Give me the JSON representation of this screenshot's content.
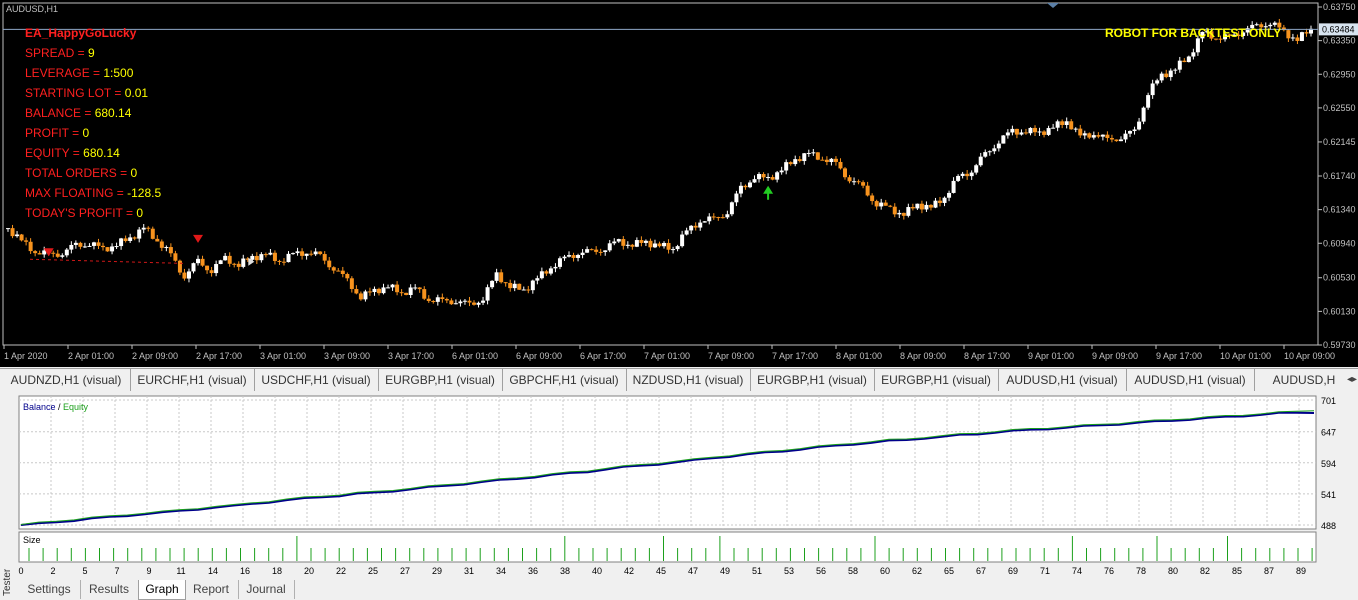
{
  "chart": {
    "symbol_label": "AUDUSD,H1",
    "watermark": "ROBOT FOR BACKTEST ONLY",
    "current_price": "0.63484",
    "bg_color": "#000000",
    "bull_color": "#ffffff",
    "bear_color": "#f7931e",
    "info_label_color": "#ff2020",
    "info_value_color": "#ffff00",
    "info": [
      {
        "label": "EA_HappyGoLucky",
        "value": ""
      },
      {
        "label": "SPREAD = ",
        "value": "9"
      },
      {
        "label": "LEVERAGE = ",
        "value": "1:500"
      },
      {
        "label": "STARTING LOT = ",
        "value": "0.01"
      },
      {
        "label": "BALANCE = ",
        "value": "680.14"
      },
      {
        "label": "PROFIT = ",
        "value": "0"
      },
      {
        "label": "EQUITY = ",
        "value": "680.14"
      },
      {
        "label": "TOTAL ORDERS = ",
        "value": "0"
      },
      {
        "label": "MAX FLOATING = ",
        "value": "-128.5"
      },
      {
        "label": "TODAY'S PROFIT = ",
        "value": "0"
      }
    ],
    "y_ticks": [
      "0.63750",
      "0.63350",
      "0.62950",
      "0.62550",
      "0.62145",
      "0.61740",
      "0.61340",
      "0.60940",
      "0.60530",
      "0.60130",
      "0.59730"
    ],
    "x_ticks": [
      "1 Apr 2020",
      "2 Apr 01:00",
      "2 Apr 09:00",
      "2 Apr 17:00",
      "3 Apr 01:00",
      "3 Apr 09:00",
      "3 Apr 17:00",
      "6 Apr 01:00",
      "6 Apr 09:00",
      "6 Apr 17:00",
      "7 Apr 01:00",
      "7 Apr 09:00",
      "7 Apr 17:00",
      "8 Apr 01:00",
      "8 Apr 09:00",
      "8 Apr 17:00",
      "9 Apr 01:00",
      "9 Apr 09:00",
      "9 Apr 17:00",
      "10 Apr 01:00",
      "10 Apr 09:00"
    ],
    "price_path": [
      0.6112,
      0.6096,
      0.6085,
      0.6079,
      0.6084,
      0.609,
      0.6095,
      0.6086,
      0.6093,
      0.61,
      0.6112,
      0.6098,
      0.6079,
      0.6056,
      0.6071,
      0.6063,
      0.6075,
      0.6069,
      0.6077,
      0.6081,
      0.6073,
      0.608,
      0.6085,
      0.6077,
      0.6066,
      0.6048,
      0.6031,
      0.6037,
      0.6043,
      0.6035,
      0.604,
      0.6028,
      0.6024,
      0.6027,
      0.6019,
      0.603,
      0.6056,
      0.6043,
      0.6038,
      0.6052,
      0.6066,
      0.6075,
      0.6084,
      0.6082,
      0.609,
      0.6095,
      0.6093,
      0.6095,
      0.6091,
      0.6088,
      0.6107,
      0.6122,
      0.6121,
      0.6133,
      0.6158,
      0.6174,
      0.617,
      0.6182,
      0.6194,
      0.62,
      0.6196,
      0.6187,
      0.6172,
      0.6158,
      0.6142,
      0.6134,
      0.6129,
      0.614,
      0.6136,
      0.615,
      0.6171,
      0.6182,
      0.6198,
      0.6217,
      0.6226,
      0.6228,
      0.6225,
      0.6232,
      0.624,
      0.622,
      0.6226,
      0.6215,
      0.6222,
      0.6225,
      0.6274,
      0.6293,
      0.6302,
      0.6316,
      0.6344,
      0.634,
      0.6337,
      0.6349,
      0.635,
      0.6358,
      0.6344,
      0.6337,
      0.6348
    ],
    "order_marks": [
      {
        "bar": 3,
        "type": "sell",
        "price": 0.6088
      },
      {
        "bar": 14,
        "type": "sell",
        "price": 0.6104
      },
      {
        "bar": 18,
        "type": "close",
        "price": 0.6072
      },
      {
        "bar": 56,
        "type": "buy",
        "price": 0.616
      }
    ]
  },
  "symbol_tabs": [
    "AUDNZD,H1 (visual)",
    "EURCHF,H1 (visual)",
    "USDCHF,H1 (visual)",
    "EURGBP,H1 (visual)",
    "GBPCHF,H1 (visual)",
    "NZDUSD,H1 (visual)",
    "EURGBP,H1 (visual)",
    "EURGBP,H1 (visual)",
    "AUDUSD,H1 (visual)",
    "AUDUSD,H1 (visual)",
    "AUDUSD,H"
  ],
  "tester": {
    "side_label": "Tester",
    "legend_balance": "Balance",
    "legend_separator": " / ",
    "legend_equity": "Equity",
    "balance_color": "#00008b",
    "equity_color": "#1ca01c",
    "size_label": "Size",
    "y_ticks": [
      "701",
      "647",
      "594",
      "541",
      "488"
    ],
    "x_ticks": [
      "0",
      "2",
      "5",
      "7",
      "9",
      "11",
      "14",
      "16",
      "18",
      "20",
      "22",
      "25",
      "27",
      "29",
      "31",
      "34",
      "36",
      "38",
      "40",
      "42",
      "45",
      "47",
      "49",
      "51",
      "53",
      "56",
      "58",
      "60",
      "62",
      "65",
      "67",
      "69",
      "71",
      "74",
      "76",
      "78",
      "80",
      "82",
      "85",
      "87",
      "89"
    ],
    "tabs": [
      "Settings",
      "Results",
      "Graph",
      "Report",
      "Journal"
    ],
    "active_tab": "Graph"
  },
  "balance_curve": {
    "type": "line",
    "series": [
      {
        "name": "Balance",
        "values": [
          488,
          490,
          493,
          496,
          499,
          501,
          504,
          507,
          509,
          512,
          515,
          518,
          520,
          524,
          527,
          530,
          533,
          536,
          538,
          541,
          543,
          546,
          549,
          552,
          555,
          558,
          561,
          564,
          567,
          570,
          573,
          576,
          579,
          583,
          586,
          589,
          592,
          595,
          598,
          602,
          605,
          608,
          611,
          614,
          617,
          620,
          623,
          626,
          628,
          631,
          633,
          636,
          638,
          641,
          643,
          646,
          648,
          650,
          652,
          654,
          656,
          658,
          660,
          662,
          664,
          666,
          668,
          670,
          672,
          674,
          676,
          678,
          679,
          680
        ]
      },
      {
        "name": "Equity",
        "values": [
          488,
          491,
          494,
          497,
          500,
          502,
          505,
          508,
          510,
          513,
          516,
          519,
          521,
          525,
          528,
          531,
          534,
          537,
          539,
          542,
          544,
          547,
          550,
          553,
          556,
          559,
          562,
          565,
          568,
          571,
          574,
          577,
          580,
          584,
          587,
          590,
          593,
          596,
          599,
          603,
          606,
          609,
          612,
          615,
          618,
          621,
          624,
          627,
          629,
          632,
          634,
          637,
          639,
          642,
          644,
          647,
          649,
          651,
          653,
          655,
          657,
          659,
          661,
          663,
          665,
          667,
          669,
          671,
          673,
          675,
          677,
          679,
          681,
          683
        ]
      }
    ],
    "ylim": [
      488,
      701
    ]
  }
}
